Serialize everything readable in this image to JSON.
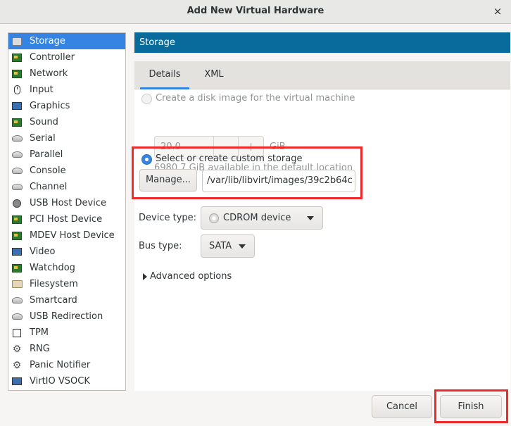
{
  "window": {
    "title": "Add New Virtual Hardware",
    "close_glyph": "×"
  },
  "sidebar": {
    "items": [
      {
        "label": "Storage",
        "icon": "disk-icon",
        "selected": true
      },
      {
        "label": "Controller",
        "icon": "board-icon"
      },
      {
        "label": "Network",
        "icon": "board-icon"
      },
      {
        "label": "Input",
        "icon": "mouse-icon"
      },
      {
        "label": "Graphics",
        "icon": "monitor-icon"
      },
      {
        "label": "Sound",
        "icon": "board-icon"
      },
      {
        "label": "Serial",
        "icon": "cable-icon"
      },
      {
        "label": "Parallel",
        "icon": "cable-icon"
      },
      {
        "label": "Console",
        "icon": "cable-icon"
      },
      {
        "label": "Channel",
        "icon": "cable-icon"
      },
      {
        "label": "USB Host Device",
        "icon": "usb-icon"
      },
      {
        "label": "PCI Host Device",
        "icon": "board-icon"
      },
      {
        "label": "MDEV Host Device",
        "icon": "board-icon"
      },
      {
        "label": "Video",
        "icon": "monitor-icon"
      },
      {
        "label": "Watchdog",
        "icon": "board-icon"
      },
      {
        "label": "Filesystem",
        "icon": "folder-icon"
      },
      {
        "label": "Smartcard",
        "icon": "cable-icon"
      },
      {
        "label": "USB Redirection",
        "icon": "cable-icon"
      },
      {
        "label": "TPM",
        "icon": "chip-icon"
      },
      {
        "label": "RNG",
        "icon": "gear-icon"
      },
      {
        "label": "Panic Notifier",
        "icon": "gear-icon"
      },
      {
        "label": "VirtIO VSOCK",
        "icon": "monitor-icon"
      }
    ]
  },
  "main": {
    "header": "Storage",
    "tabs": {
      "details": "Details",
      "xml": "XML"
    },
    "disk_image": {
      "label": "Create a disk image for the virtual machine",
      "size_value": "20.0",
      "minus": "−",
      "plus": "+",
      "unit": "GiB",
      "available": "6980.7 GiB available in the default location"
    },
    "custom_storage": {
      "label": "Select or create custom storage",
      "manage_button": "Manage...",
      "path": "/var/lib/libvirt/images/39c2b64c"
    },
    "device_type": {
      "label": "Device type:",
      "value": "CDROM device"
    },
    "bus_type": {
      "label": "Bus type:",
      "value": "SATA"
    },
    "advanced": "Advanced options"
  },
  "footer": {
    "cancel": "Cancel",
    "finish": "Finish"
  },
  "colors": {
    "header_bg": "#086b9b",
    "selection": "#3584e4",
    "highlight": "#ee2a2a"
  }
}
